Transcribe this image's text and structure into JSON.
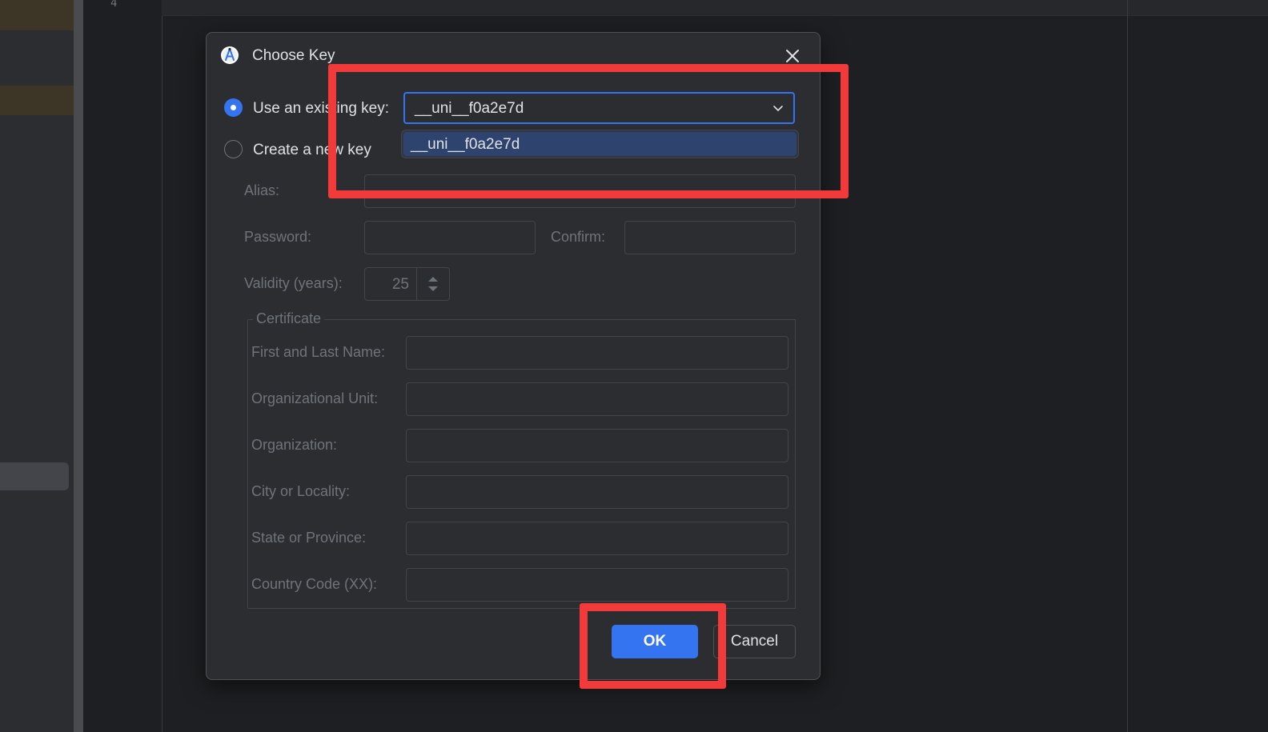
{
  "editor": {
    "line_number": "4"
  },
  "dialog": {
    "title": "Choose Key",
    "app_icon": "android-studio-icon",
    "close_icon": "close-icon",
    "use_existing_label": "Use an existing key:",
    "create_new_label": "Create a new key",
    "use_existing_selected": true,
    "key_dropdown": {
      "value": "__uni__f0a2e7d",
      "options": [
        "__uni__f0a2e7d"
      ]
    },
    "alias_label": "Alias:",
    "password_label": "Password:",
    "confirm_label": "Confirm:",
    "validity_label": "Validity (years):",
    "validity_value": "25",
    "certificate": {
      "title": "Certificate",
      "fields": [
        {
          "label": "First and Last Name:"
        },
        {
          "label": "Organizational Unit:"
        },
        {
          "label": "Organization:"
        },
        {
          "label": "City or Locality:"
        },
        {
          "label": "State or Province:"
        },
        {
          "label": "Country Code (XX):"
        }
      ]
    },
    "ok_label": "OK",
    "cancel_label": "Cancel"
  },
  "colors": {
    "accent": "#3574f0",
    "annotation": "#f23a3a",
    "dialog_bg": "#2b2d30"
  }
}
